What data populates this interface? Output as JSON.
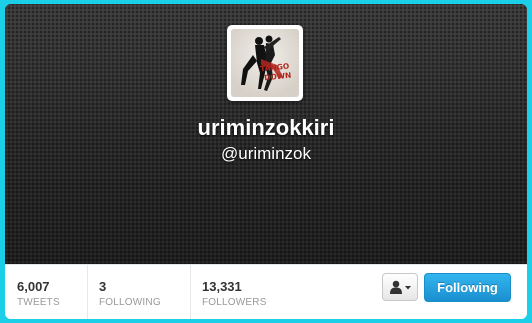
{
  "profile": {
    "name": "uriminzokkiri",
    "screen_name": "@uriminzok",
    "avatar_text_line1": "TANGO",
    "avatar_text_line2": "DOWN"
  },
  "stats": [
    {
      "value": "6,007",
      "label": "TWEETS"
    },
    {
      "value": "3",
      "label": "FOLLOWING"
    },
    {
      "value": "13,331",
      "label": "FOLLOWERS"
    }
  ],
  "actions": {
    "user_menu_icon": "user-icon",
    "follow_label": "Following"
  },
  "colors": {
    "frame": "#1ccfe8",
    "follow_button": "#2aa6e3",
    "header": "#2b2b2b"
  }
}
